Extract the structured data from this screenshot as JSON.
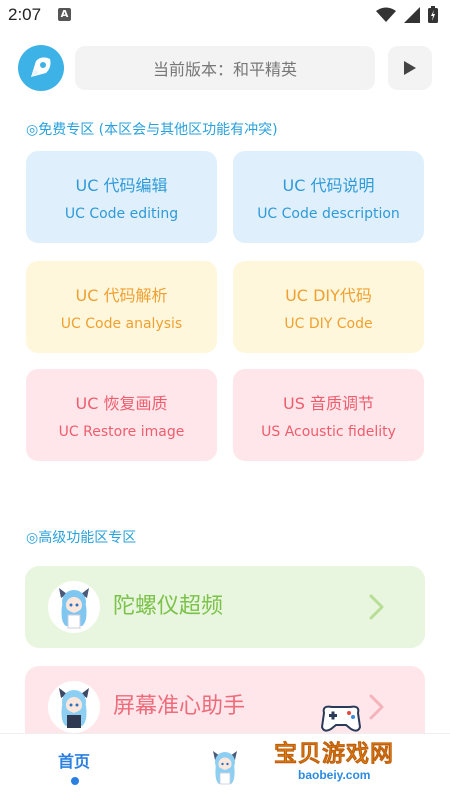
{
  "status_bar": {
    "time": "2:07",
    "notif_letter": "A"
  },
  "header": {
    "version_label": "当前版本：和平精英"
  },
  "free_section": {
    "title": "◎免费专区 (本区会与其他区功能有冲突)",
    "cards": [
      {
        "title": "UC 代码编辑",
        "subtitle": "UC Code editing",
        "color": "blue"
      },
      {
        "title": "UC 代码说明",
        "subtitle": "UC Code description",
        "color": "blue"
      },
      {
        "title": "UC 代码解析",
        "subtitle": "UC Code analysis",
        "color": "yellow"
      },
      {
        "title": "UC DIY代码",
        "subtitle": "UC DIY Code",
        "color": "yellow"
      },
      {
        "title": "UC 恢复画质",
        "subtitle": "UC Restore image",
        "color": "pink"
      },
      {
        "title": "US 音质调节",
        "subtitle": "US Acoustic fidelity",
        "color": "pink"
      }
    ]
  },
  "pro_section": {
    "title": "◎高级功能区专区",
    "items": [
      {
        "label": "陀螺仪超频"
      },
      {
        "label": "屏幕准心助手"
      }
    ]
  },
  "bottom_nav": {
    "home_label": "首页"
  },
  "watermark": {
    "text": "宝贝游戏网",
    "url": "baobeiy.com"
  },
  "colors": {
    "accent": "#29a2dc",
    "blue_card": "#dff0fc",
    "yellow_card": "#fff7dc",
    "pink_card": "#ffe6ea",
    "green_card": "#e9f6df",
    "nav_active": "#2b7fe0"
  }
}
